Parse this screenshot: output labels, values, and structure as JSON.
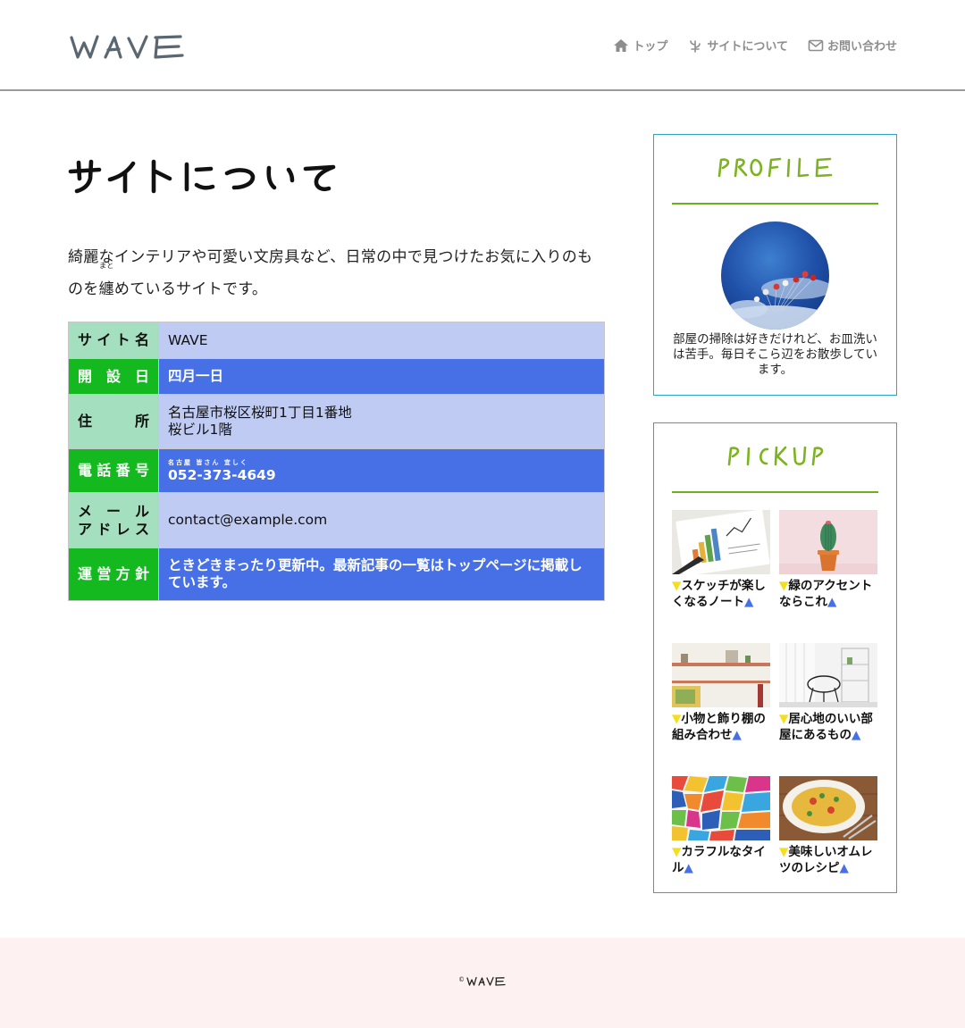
{
  "header": {
    "logo_text": "WAVE",
    "nav": [
      {
        "label": "トップ",
        "icon": "home-icon"
      },
      {
        "label": "サイトについて",
        "icon": "sprout-icon"
      },
      {
        "label": "お問い合わせ",
        "icon": "mail-icon"
      }
    ]
  },
  "main": {
    "title": "サイトについて",
    "intro_before": "綺麗なインテリアや可愛い文房具など、日常の中で見つけたお気に入りのものを",
    "intro_ruby_base": "纏",
    "intro_ruby_text": "まと",
    "intro_after": "めているサイトです。",
    "table": [
      {
        "label": "サイト名",
        "value": "WAVE"
      },
      {
        "label": "開設日",
        "value": "四月一日"
      },
      {
        "label": "住所",
        "value": "名古屋市桜区桜町1丁目1番地",
        "value2": "桜ビル1階"
      },
      {
        "label": "電話番号",
        "ruby": "名古屋 皆さん 宜しく",
        "value": "052-373-4649"
      },
      {
        "label": "メール",
        "label2": "アドレス",
        "value": "contact@example.com"
      },
      {
        "label": "運営方針",
        "value": "ときどきまったり更新中。最新記事の一覧はトップページに掲載しています。"
      }
    ]
  },
  "sidebar": {
    "profile_title": "PROFILE",
    "profile_text": "部屋の掃除は好きだけれど、お皿洗いは苦手。毎日そこら辺をお散歩しています。",
    "pickup_title": "PICKUP",
    "pickup": [
      {
        "caption": "スケッチが楽しくなるノート"
      },
      {
        "caption": "緑のアクセントならこれ"
      },
      {
        "caption": "小物と飾り棚の組み合わせ"
      },
      {
        "caption": "居心地のいい部屋にあるもの"
      },
      {
        "caption": "カラフルなタイル"
      },
      {
        "caption": "美味しいオムレツのレシピ"
      }
    ],
    "marker_down": "▼",
    "marker_up": "▲"
  },
  "footer": {
    "copyright_symbol": "©",
    "brand": "WAVE"
  },
  "colors": {
    "accent_green": "#13b91f",
    "accent_blue": "#4770e6",
    "widget_border": "#2ba7c4",
    "title_green": "#7db221"
  }
}
